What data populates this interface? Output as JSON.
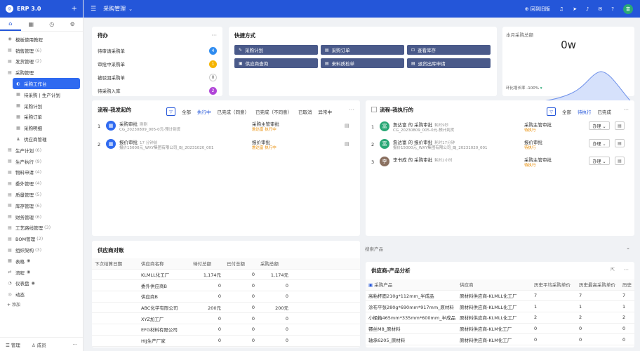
{
  "app": {
    "logo_letter": "ERP",
    "name": "ERP 3.0",
    "plus": "+"
  },
  "sidebar": {
    "tabs": [
      {
        "icon": "home-icon",
        "glyph": "⌂"
      },
      {
        "icon": "table-icon",
        "glyph": "▦"
      },
      {
        "icon": "clock-icon",
        "glyph": "◷"
      },
      {
        "icon": "tool-icon",
        "glyph": "⚙"
      }
    ],
    "items": [
      {
        "label": "模板使用教程",
        "count": "",
        "glyph": "◉"
      },
      {
        "label": "销售管理",
        "count": "(6)",
        "glyph": "▤"
      },
      {
        "label": "发货管理",
        "count": "(2)",
        "glyph": "▤"
      },
      {
        "label": "采购管理",
        "count": "",
        "glyph": "▤"
      },
      {
        "label": "采购工作台",
        "count": "",
        "glyph": "◐",
        "sub": true,
        "active": true
      },
      {
        "label": "待采购 | 生产计划",
        "count": "",
        "glyph": "▦",
        "sub": true
      },
      {
        "label": "采购计划",
        "count": "",
        "glyph": "▦",
        "sub": true
      },
      {
        "label": "采购订单",
        "count": "",
        "glyph": "▦",
        "sub": true
      },
      {
        "label": "采购明细",
        "count": "",
        "glyph": "▦",
        "sub": true
      },
      {
        "label": "供应商管理",
        "count": "",
        "glyph": "♟",
        "sub": true
      },
      {
        "label": "生产计划",
        "count": "(6)",
        "glyph": "▤"
      },
      {
        "label": "生产执行",
        "count": "(9)",
        "glyph": "▤"
      },
      {
        "label": "物料申请",
        "count": "(4)",
        "glyph": "▤"
      },
      {
        "label": "委外管理",
        "count": "(4)",
        "glyph": "▤"
      },
      {
        "label": "质量管理",
        "count": "(5)",
        "glyph": "▤"
      },
      {
        "label": "库存管理",
        "count": "(6)",
        "glyph": "▤"
      },
      {
        "label": "财务管理",
        "count": "(6)",
        "glyph": "▤"
      },
      {
        "label": "工艺路线管理",
        "count": "(3)",
        "glyph": "▤"
      },
      {
        "label": "BOM管理",
        "count": "(2)",
        "glyph": "▤"
      },
      {
        "label": "组织架构",
        "count": "(3)",
        "glyph": "▤"
      },
      {
        "label": "表格",
        "count": "",
        "glyph": "▦",
        "eye": true
      },
      {
        "label": "流程",
        "count": "",
        "glyph": "⇄",
        "eye": true
      },
      {
        "label": "仪表盘",
        "count": "",
        "glyph": "◔",
        "eye": true
      },
      {
        "label": "动态",
        "count": "",
        "glyph": "◎"
      }
    ],
    "add_label": "+ 添加",
    "footer": {
      "manage": "☰  管理",
      "members": "♙  成员",
      "more": "···"
    }
  },
  "topbar": {
    "title": "采购管理",
    "caret": "⌄",
    "back_old": "⊕ 回到旧版",
    "icons": [
      "headset-icon",
      "send-icon",
      "bell-icon",
      "mail-icon",
      "help-icon"
    ],
    "avatar": "富"
  },
  "todo": {
    "title": "待办",
    "rows": [
      {
        "label": "待审请采购单",
        "count": "4",
        "color": "#2f8cf0"
      },
      {
        "label": "审批中采购单",
        "count": "1",
        "color": "#f5b400"
      },
      {
        "label": "被驳回采购单",
        "count": "0",
        "color": "#cccccc"
      },
      {
        "label": "待采购入库",
        "count": "2",
        "color": "#b145d8"
      }
    ]
  },
  "shortcuts": {
    "title": "快捷方式",
    "buttons": [
      {
        "label": "采购计划",
        "glyph": "✎"
      },
      {
        "label": "采购订单",
        "glyph": "▤"
      },
      {
        "label": "查看库存",
        "glyph": "⊡"
      },
      {
        "label": "供应商查询",
        "glyph": "▣"
      },
      {
        "label": "来料质检单",
        "glyph": "▤"
      },
      {
        "label": "退货出库申请",
        "glyph": "▤"
      }
    ]
  },
  "monthly": {
    "title": "本月采购总额",
    "value": "0w",
    "footer": "环比增长率 -100%",
    "trend_glyph": "▾"
  },
  "flow_mine": {
    "title": "流程-我发起的",
    "filters": [
      "全部",
      "执行中",
      "已完成（同意）",
      "已完成（不同意）",
      "已取消",
      "异常中"
    ],
    "active_filter": "执行中",
    "rows": [
      {
        "num": "1",
        "name": "采购审批",
        "time": "刚刚",
        "sub": "CG_20230809_005-0元-预计到货",
        "stage": "采购主管审批",
        "status": "詹达富 执行中"
      },
      {
        "num": "2",
        "name": "报价审批",
        "time": "17 分钟前",
        "sub": "报价15000元_WXY集团有限公司_BJ_20231020_001",
        "stage": "报价审批",
        "status": "詹达富 执行中"
      }
    ]
  },
  "flow_exec": {
    "title": "流程-我执行的",
    "filters": [
      "全部",
      "待执行",
      "已完成"
    ],
    "active_filter": "待执行",
    "rows": [
      {
        "num": "1",
        "avatar": "富",
        "name": "詹达富 的 采购审批",
        "time": "耗时9秒",
        "sub": "CG_20230809_005-0元-预计到货",
        "stage": "采购主管审批",
        "status": "待执行",
        "action": "办理 ⌄"
      },
      {
        "num": "2",
        "avatar": "富",
        "name": "詹达富 的 报价审批",
        "time": "耗时17分钟",
        "sub": "报价15000元_WXY集团有限公司_BJ_20231020_001",
        "stage": "报价审批",
        "status": "待执行",
        "action": "办理 ⌄"
      },
      {
        "num": "3",
        "avatar": "李",
        "name": "李书成 的 采购审批",
        "time": "耗时2小时",
        "sub": "",
        "stage": "采购主管审批",
        "status": "待执行",
        "action": "办理 ⌄"
      }
    ]
  },
  "supplier_ledger": {
    "title": "供应商对账",
    "headers": [
      "下次结算日期",
      "供应商名称",
      "待付总额",
      "已付总额",
      "采购总额"
    ],
    "rows": [
      [
        "",
        "KLMLL化工厂",
        "1,174元",
        "0",
        "1,174元"
      ],
      [
        "",
        "委外供应商B",
        "0",
        "0",
        "0"
      ],
      [
        "",
        "供应商B",
        "0",
        "0",
        "0"
      ],
      [
        "",
        "ABC化学有限公司",
        "200元",
        "0",
        "200元"
      ],
      [
        "",
        "XYZ加工厂",
        "0",
        "0",
        "0"
      ],
      [
        "",
        "EFG材料有限公司",
        "0",
        "0",
        "0"
      ],
      [
        "",
        "HIJ生产厂家",
        "0",
        "0",
        "0"
      ]
    ]
  },
  "search_product": {
    "placeholder": "搜索产品"
  },
  "product_analysis": {
    "title": "供应商-产品分析",
    "headers": [
      "采购产品",
      "供应商",
      "历史平均采购单价",
      "历史最高采购单价",
      "历史"
    ],
    "rows": [
      [
        "高粘杯面210g*112mm_半成品",
        "原材料供应商-KLMLL化工厂",
        "7",
        "7",
        "7"
      ],
      [
        "涂布平张280g*690mm*917mm_原材料",
        "原材料供应商-KLMLL化工厂",
        "1",
        "1",
        "1"
      ],
      [
        "小桶箱465mm*335mm*600mm_半成品",
        "原材料供应商-KLMLL化工厂",
        "2",
        "2",
        "2"
      ],
      [
        "镙丝M8_原材料",
        "原材料供应商-KLM化工厂",
        "0",
        "0",
        "0"
      ],
      [
        "轴承6205_原材料",
        "原材料供应商-KLM化工厂",
        "0",
        "0",
        "0"
      ]
    ]
  }
}
